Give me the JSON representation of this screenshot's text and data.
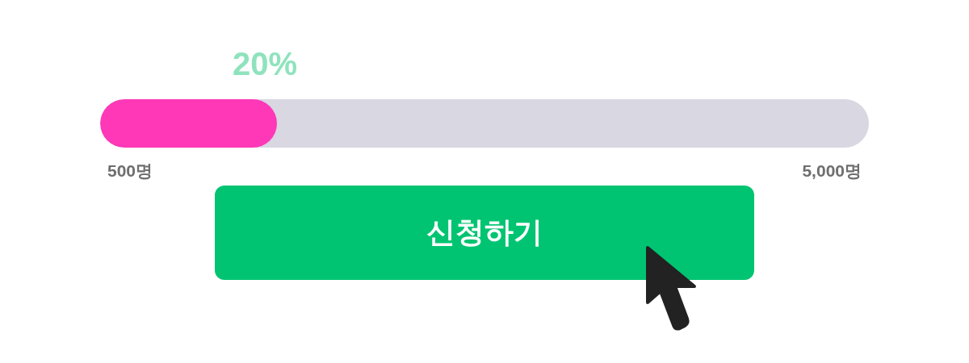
{
  "progress": {
    "reading": "20%",
    "level": 0.23,
    "min_label": "500명",
    "max_label": "5,000명"
  },
  "button": {
    "label": "신청하기"
  }
}
